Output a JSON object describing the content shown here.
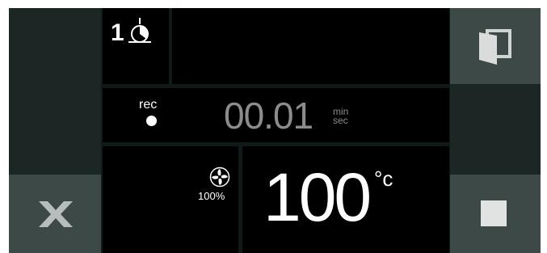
{
  "step": {
    "number": "1",
    "icon": "step-timer-icon"
  },
  "timer": {
    "rec_label": "rec",
    "value": "00.01",
    "unit_top": "min",
    "unit_bottom": "sec"
  },
  "fan": {
    "icon": "fan-icon",
    "percent": "100%"
  },
  "temperature": {
    "value": "100",
    "unit": "°c"
  },
  "buttons": {
    "door": "door-icon",
    "cancel": "close-x-icon",
    "stop": "stop-icon"
  },
  "colors": {
    "panel": "#000000",
    "background": "#0f1a19",
    "button_light": "#3d4947",
    "button_dark": "#1b2625",
    "text_dim": "#8c8c8c",
    "text": "#ffffff"
  }
}
